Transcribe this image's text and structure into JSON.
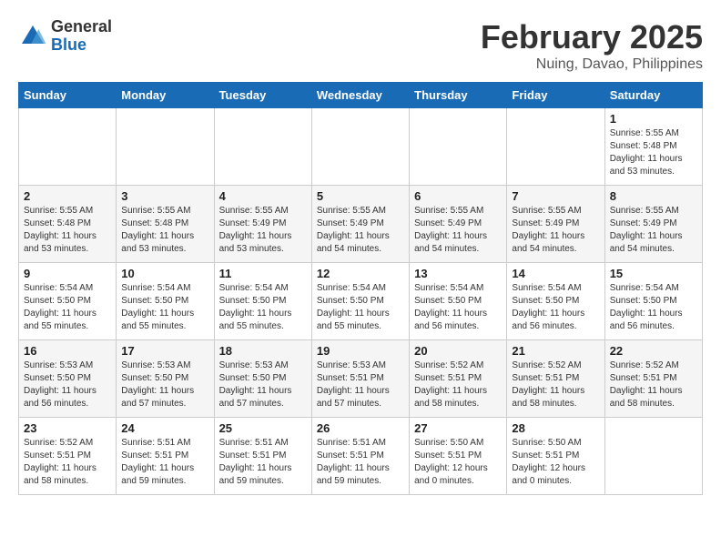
{
  "logo": {
    "general": "General",
    "blue": "Blue"
  },
  "header": {
    "month": "February 2025",
    "location": "Nuing, Davao, Philippines"
  },
  "weekdays": [
    "Sunday",
    "Monday",
    "Tuesday",
    "Wednesday",
    "Thursday",
    "Friday",
    "Saturday"
  ],
  "weeks": [
    [
      {
        "day": "",
        "info": ""
      },
      {
        "day": "",
        "info": ""
      },
      {
        "day": "",
        "info": ""
      },
      {
        "day": "",
        "info": ""
      },
      {
        "day": "",
        "info": ""
      },
      {
        "day": "",
        "info": ""
      },
      {
        "day": "1",
        "info": "Sunrise: 5:55 AM\nSunset: 5:48 PM\nDaylight: 11 hours\nand 53 minutes."
      }
    ],
    [
      {
        "day": "2",
        "info": "Sunrise: 5:55 AM\nSunset: 5:48 PM\nDaylight: 11 hours\nand 53 minutes."
      },
      {
        "day": "3",
        "info": "Sunrise: 5:55 AM\nSunset: 5:48 PM\nDaylight: 11 hours\nand 53 minutes."
      },
      {
        "day": "4",
        "info": "Sunrise: 5:55 AM\nSunset: 5:49 PM\nDaylight: 11 hours\nand 53 minutes."
      },
      {
        "day": "5",
        "info": "Sunrise: 5:55 AM\nSunset: 5:49 PM\nDaylight: 11 hours\nand 54 minutes."
      },
      {
        "day": "6",
        "info": "Sunrise: 5:55 AM\nSunset: 5:49 PM\nDaylight: 11 hours\nand 54 minutes."
      },
      {
        "day": "7",
        "info": "Sunrise: 5:55 AM\nSunset: 5:49 PM\nDaylight: 11 hours\nand 54 minutes."
      },
      {
        "day": "8",
        "info": "Sunrise: 5:55 AM\nSunset: 5:49 PM\nDaylight: 11 hours\nand 54 minutes."
      }
    ],
    [
      {
        "day": "9",
        "info": "Sunrise: 5:54 AM\nSunset: 5:50 PM\nDaylight: 11 hours\nand 55 minutes."
      },
      {
        "day": "10",
        "info": "Sunrise: 5:54 AM\nSunset: 5:50 PM\nDaylight: 11 hours\nand 55 minutes."
      },
      {
        "day": "11",
        "info": "Sunrise: 5:54 AM\nSunset: 5:50 PM\nDaylight: 11 hours\nand 55 minutes."
      },
      {
        "day": "12",
        "info": "Sunrise: 5:54 AM\nSunset: 5:50 PM\nDaylight: 11 hours\nand 55 minutes."
      },
      {
        "day": "13",
        "info": "Sunrise: 5:54 AM\nSunset: 5:50 PM\nDaylight: 11 hours\nand 56 minutes."
      },
      {
        "day": "14",
        "info": "Sunrise: 5:54 AM\nSunset: 5:50 PM\nDaylight: 11 hours\nand 56 minutes."
      },
      {
        "day": "15",
        "info": "Sunrise: 5:54 AM\nSunset: 5:50 PM\nDaylight: 11 hours\nand 56 minutes."
      }
    ],
    [
      {
        "day": "16",
        "info": "Sunrise: 5:53 AM\nSunset: 5:50 PM\nDaylight: 11 hours\nand 56 minutes."
      },
      {
        "day": "17",
        "info": "Sunrise: 5:53 AM\nSunset: 5:50 PM\nDaylight: 11 hours\nand 57 minutes."
      },
      {
        "day": "18",
        "info": "Sunrise: 5:53 AM\nSunset: 5:50 PM\nDaylight: 11 hours\nand 57 minutes."
      },
      {
        "day": "19",
        "info": "Sunrise: 5:53 AM\nSunset: 5:51 PM\nDaylight: 11 hours\nand 57 minutes."
      },
      {
        "day": "20",
        "info": "Sunrise: 5:52 AM\nSunset: 5:51 PM\nDaylight: 11 hours\nand 58 minutes."
      },
      {
        "day": "21",
        "info": "Sunrise: 5:52 AM\nSunset: 5:51 PM\nDaylight: 11 hours\nand 58 minutes."
      },
      {
        "day": "22",
        "info": "Sunrise: 5:52 AM\nSunset: 5:51 PM\nDaylight: 11 hours\nand 58 minutes."
      }
    ],
    [
      {
        "day": "23",
        "info": "Sunrise: 5:52 AM\nSunset: 5:51 PM\nDaylight: 11 hours\nand 58 minutes."
      },
      {
        "day": "24",
        "info": "Sunrise: 5:51 AM\nSunset: 5:51 PM\nDaylight: 11 hours\nand 59 minutes."
      },
      {
        "day": "25",
        "info": "Sunrise: 5:51 AM\nSunset: 5:51 PM\nDaylight: 11 hours\nand 59 minutes."
      },
      {
        "day": "26",
        "info": "Sunrise: 5:51 AM\nSunset: 5:51 PM\nDaylight: 11 hours\nand 59 minutes."
      },
      {
        "day": "27",
        "info": "Sunrise: 5:50 AM\nSunset: 5:51 PM\nDaylight: 12 hours\nand 0 minutes."
      },
      {
        "day": "28",
        "info": "Sunrise: 5:50 AM\nSunset: 5:51 PM\nDaylight: 12 hours\nand 0 minutes."
      },
      {
        "day": "",
        "info": ""
      }
    ]
  ]
}
